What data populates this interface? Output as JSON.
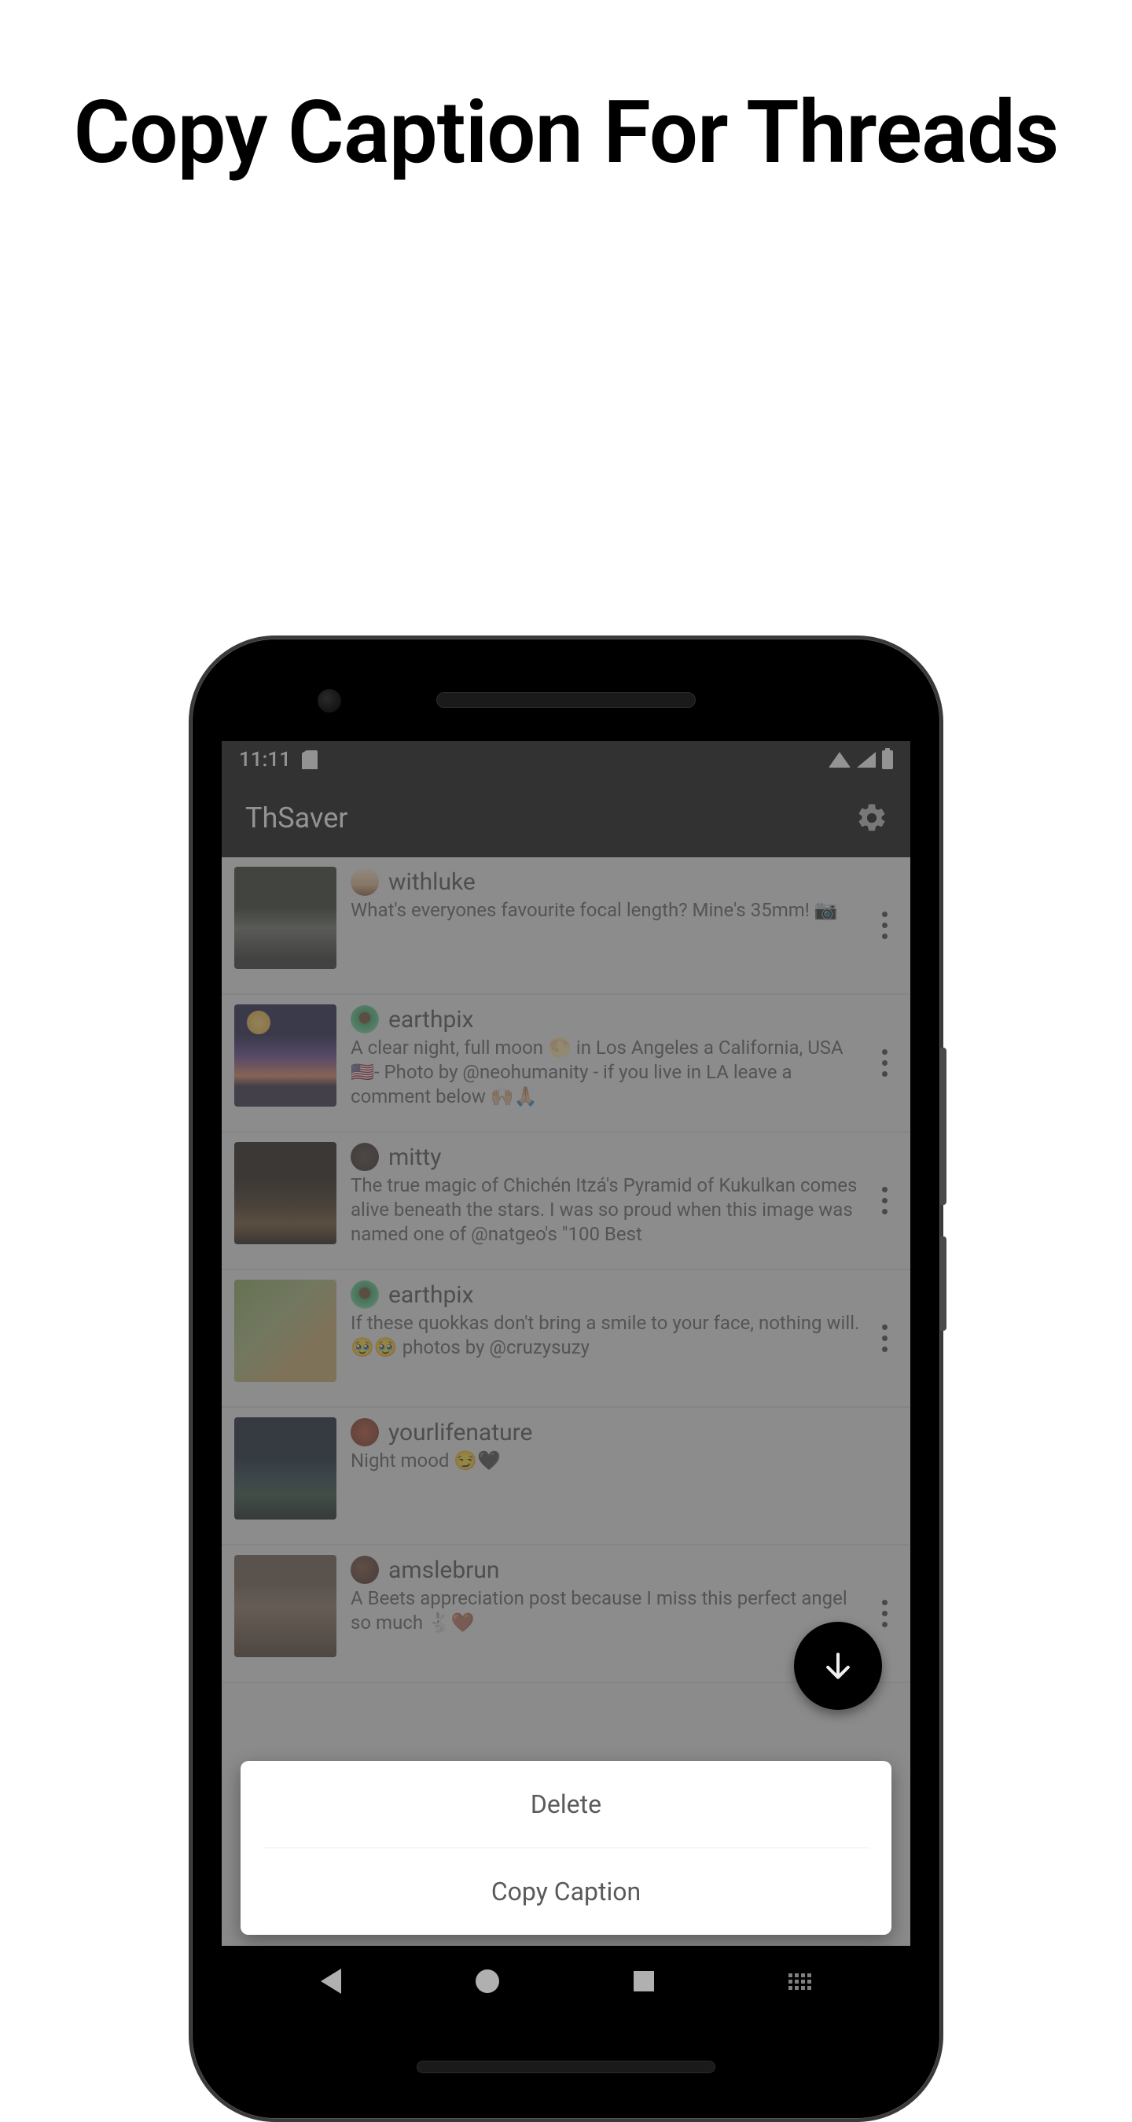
{
  "headline": "Copy Caption For Threads",
  "statusbar": {
    "time": "11:11"
  },
  "appbar": {
    "title": "ThSaver"
  },
  "posts": [
    {
      "user": "withluke",
      "caption": "What's everyones favourite focal length? Mine's 35mm! 📷"
    },
    {
      "user": "earthpix",
      "caption": "A clear night, full moon 🌕 in Los Angeles a California, USA 🇺🇸- Photo by @neohumanity - if you live in LA leave a comment below 🙌🏼🙏🏼"
    },
    {
      "user": "mitty",
      "caption": "The true magic of Chichén Itzá's Pyramid of Kukulkan comes alive beneath the stars. I was so proud when this image was named one of @natgeo's \"100 Best"
    },
    {
      "user": "earthpix",
      "caption": "If these quokkas don't bring a smile to your face, nothing will. 🥹🥹 photos by @cruzysuzy"
    },
    {
      "user": "yourlifenature",
      "caption": "Night mood 😏🖤"
    },
    {
      "user": "amslebrun",
      "caption": "A Beets appreciation post because I miss this perfect angel so much 🐇🤎"
    }
  ],
  "sheet": {
    "delete": "Delete",
    "copy": "Copy Caption"
  }
}
